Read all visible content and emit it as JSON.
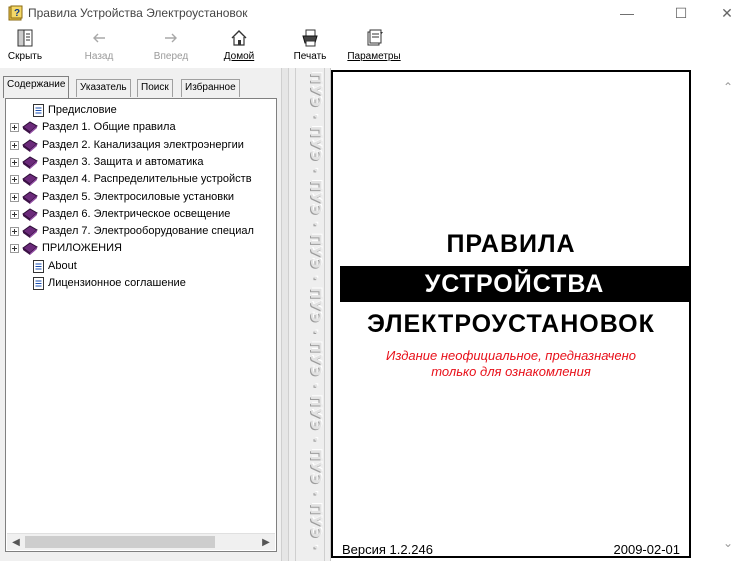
{
  "window": {
    "title": "Правила Устройства Электроустановок",
    "minimize_glyph": "—",
    "maximize_glyph": "☐",
    "close_glyph": "✕"
  },
  "toolbar": {
    "hide": "Скрыть",
    "back": "Назад",
    "forward": "Вперед",
    "home": "Домой",
    "print": "Печать",
    "options": "Параметры"
  },
  "tabs": [
    "Содержание",
    "Указатель",
    "Поиск",
    "Избранное"
  ],
  "tree": [
    {
      "label": "Предисловие",
      "type": "page"
    },
    {
      "label": "Раздел 1. Общие правила",
      "type": "book"
    },
    {
      "label": "Раздел 2. Канализация электроэнергии",
      "type": "book"
    },
    {
      "label": "Раздел 3. Защита и автоматика",
      "type": "book"
    },
    {
      "label": "Раздел 4. Распределительные устройств",
      "type": "book"
    },
    {
      "label": "Раздел 5. Электросиловые установки",
      "type": "book"
    },
    {
      "label": "Раздел 6. Электрическое освещение",
      "type": "book"
    },
    {
      "label": "Раздел 7. Электрооборудование специал",
      "type": "book"
    },
    {
      "label": "ПРИЛОЖЕНИЯ",
      "type": "book"
    },
    {
      "label": "About",
      "type": "page"
    },
    {
      "label": "Лицензионное соглашение",
      "type": "page"
    }
  ],
  "strip_text": "ПУЭ · ПУЭ · ПУЭ · ПУЭ · ПУЭ · ПУЭ · ПУЭ · ПУЭ · ПУЭ · ПУЭ",
  "cover": {
    "line1": "ПРАВИЛА",
    "line2": "УСТРОЙСТВА",
    "line3": "ЭЛЕКТРОУСТАНОВОК",
    "note_line1": "Издание неофициальное, предназначено",
    "note_line2": "только для ознакомления",
    "version": "Версия 1.2.246",
    "date": "2009-02-01"
  },
  "colors": {
    "note": "#e8101a",
    "book": "#6b2a7a",
    "pane_bg": "#f0f0f0"
  },
  "icons": {
    "app": "help-book-icon",
    "hide": "hide-pane-icon",
    "back": "arrow-left-icon",
    "forward": "arrow-right-icon",
    "home": "home-icon",
    "print": "printer-icon",
    "options": "options-icon"
  }
}
